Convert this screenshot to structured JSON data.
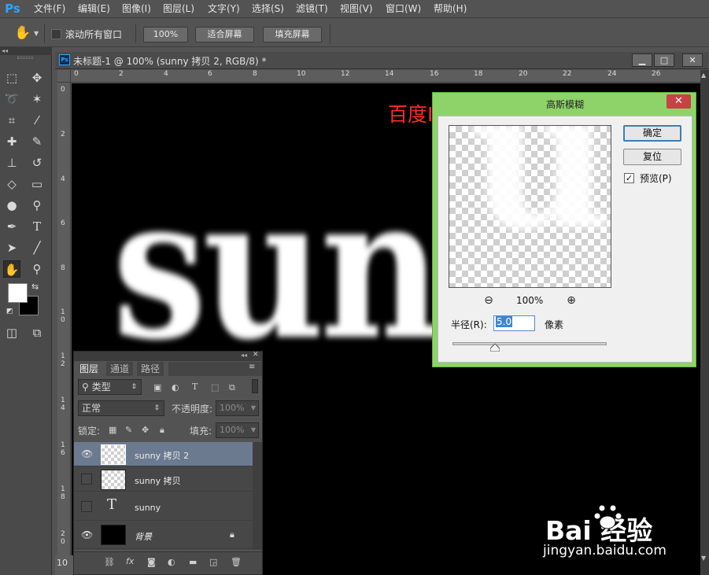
{
  "app": {
    "logo": "Ps"
  },
  "menu": [
    "文件(F)",
    "编辑(E)",
    "图像(I)",
    "图层(L)",
    "文字(Y)",
    "选择(S)",
    "滤镜(T)",
    "视图(V)",
    "窗口(W)",
    "帮助(H)"
  ],
  "options": {
    "scroll_all": "滚动所有窗口",
    "zoom": "100%",
    "fit_screen": "适合屏幕",
    "fill_screen": "填充屏幕"
  },
  "document": {
    "title": "未标题-1 @ 100% (sunny 拷贝 2, RGB/8) *",
    "canvas_text": "sun",
    "ruler_top": [
      "0",
      "2",
      "4",
      "6",
      "8",
      "10",
      "12",
      "14",
      "16",
      "18",
      "20",
      "22",
      "24",
      "26"
    ],
    "ruler_left": [
      "0",
      "2",
      "4",
      "6",
      "8",
      "1 0",
      "1 2",
      "1 4",
      "1 6",
      "1 8",
      "2 0"
    ],
    "zoom_readout": "10"
  },
  "watermark_id": "百度ID：sunnyMelody夏",
  "gaussian_blur": {
    "title": "高斯模糊",
    "ok": "确定",
    "reset": "复位",
    "preview_label": "预览(P)",
    "preview_checked": true,
    "zoom": "100%",
    "radius_label": "半径(R):",
    "radius_value": "5.0",
    "unit": "像素",
    "radius_slider_fraction": 0.27
  },
  "layers_panel": {
    "tabs": [
      "图层",
      "通道",
      "路径"
    ],
    "filter_kind": "类型",
    "blend_mode": "正常",
    "opacity_label": "不透明度:",
    "opacity_value": "100%",
    "lock_label": "锁定:",
    "fill_label": "填充:",
    "fill_value": "100%",
    "layers": [
      {
        "name": "sunny 拷贝 2",
        "visible": true,
        "selected": true
      },
      {
        "name": "sunny 拷贝",
        "visible": false,
        "selected": false
      },
      {
        "name": "sunny",
        "visible": false,
        "selected": false,
        "type": "text"
      },
      {
        "name": "背景",
        "visible": true,
        "selected": false,
        "locked": true
      }
    ]
  },
  "baidu": {
    "logo": "Bai  经验",
    "url": "jingyan.baidu.com"
  },
  "colors": {
    "accent": "#2fa3ff",
    "dialog_frame": "#8ed36a",
    "watermark_red": "#ff2a2a",
    "selected_layer": "#6c7a90"
  }
}
